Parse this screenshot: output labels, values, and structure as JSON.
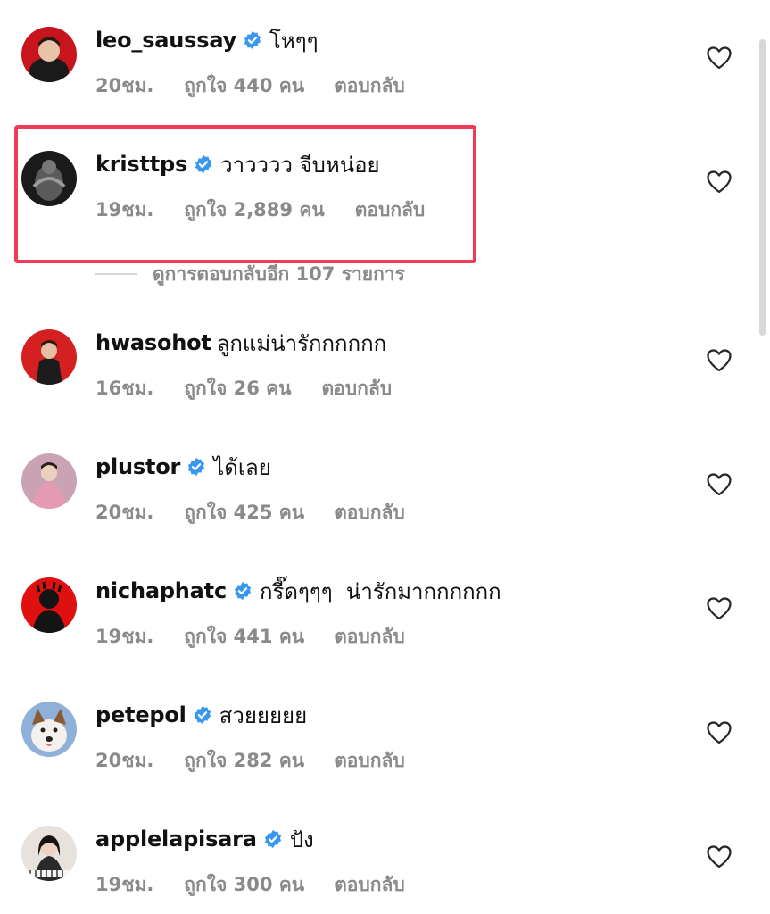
{
  "comments": [
    {
      "username": "leo_saussay",
      "verified": true,
      "text": "โหๆๆ",
      "time": "20ชม.",
      "likes": "ถูกใจ 440 คน",
      "reply": "ตอบกลับ",
      "avatar_color": "#c8141c"
    },
    {
      "username": "kristtps",
      "verified": true,
      "text": "วาวววว จีบหน่อย",
      "time": "19ชม.",
      "likes": "ถูกใจ 2,889 คน",
      "reply": "ตอบกลับ",
      "avatar_color": "#1a1a1a"
    },
    {
      "username": "hwasohot",
      "verified": false,
      "text": "ลูกแม่น่ารักกกกกก",
      "time": "16ชม.",
      "likes": "ถูกใจ 26 คน",
      "reply": "ตอบกลับ",
      "avatar_color": "#d42020"
    },
    {
      "username": "plustor",
      "verified": true,
      "text": "ได้เลย",
      "time": "20ชม.",
      "likes": "ถูกใจ 425 คน",
      "reply": "ตอบกลับ",
      "avatar_color": "#c9a3b3"
    },
    {
      "username": "nichaphatc",
      "verified": true,
      "text": "กรี๊ดๆๆๆ  น่ารักมากกกกกก",
      "time": "19ชม.",
      "likes": "ถูกใจ 441 คน",
      "reply": "ตอบกลับ",
      "avatar_color": "#e01010"
    },
    {
      "username": "petepol",
      "verified": true,
      "text": "สวยยยยย",
      "time": "20ชม.",
      "likes": "ถูกใจ 282 คน",
      "reply": "ตอบกลับ",
      "avatar_color": "#8fb0d8"
    },
    {
      "username": "applelapisara",
      "verified": true,
      "text": "ปัง",
      "time": "19ชม.",
      "likes": "ถูกใจ 300 คน",
      "reply": "ตอบกลับ",
      "avatar_color": "#e8e2dc"
    }
  ],
  "view_replies": "ดูการตอบกลับอีก 107 รายการ",
  "colors": {
    "verified_badge": "#3897f0",
    "highlight_border": "#ef3b55",
    "meta_text": "#8a8a8a"
  },
  "icons": {
    "verified": "verified-badge-icon",
    "like": "heart-outline-icon"
  }
}
